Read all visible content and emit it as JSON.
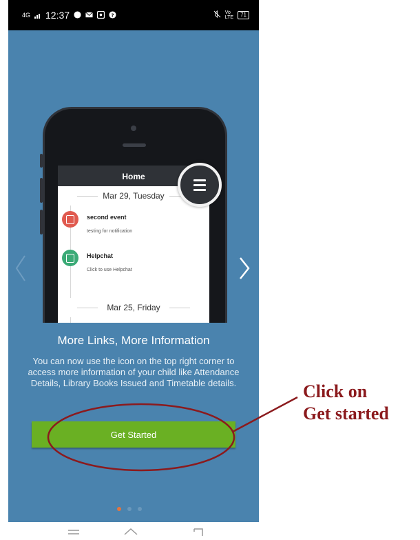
{
  "status_bar": {
    "network": "4G",
    "time": "12:37",
    "battery": "71"
  },
  "illustration": {
    "app_header": "Home",
    "date_1": "Mar 29, Tuesday",
    "events": [
      {
        "title": "second event",
        "subtitle": "testing for notification",
        "color": "#e05a4f",
        "icon": "calendar-icon"
      },
      {
        "title": "Helpchat",
        "subtitle": "Click to use Helpchat",
        "color": "#3aaa76",
        "icon": "document-icon"
      }
    ],
    "date_2": "Mar 25, Friday"
  },
  "onboarding": {
    "title": "More Links, More Information",
    "description": "You can now use the icon on the top right corner to access more information of your child like Attendance Details, Library Books Issued and Timetable details.",
    "button_label": "Get Started",
    "page_count": 3,
    "active_page": 1
  },
  "annotation": {
    "line_1": "Click on",
    "line_2": "Get started",
    "color": "#8b1a1d"
  },
  "colors": {
    "background": "#4a83ae",
    "button": "#6ab023",
    "active_dot": "#e3753f"
  }
}
